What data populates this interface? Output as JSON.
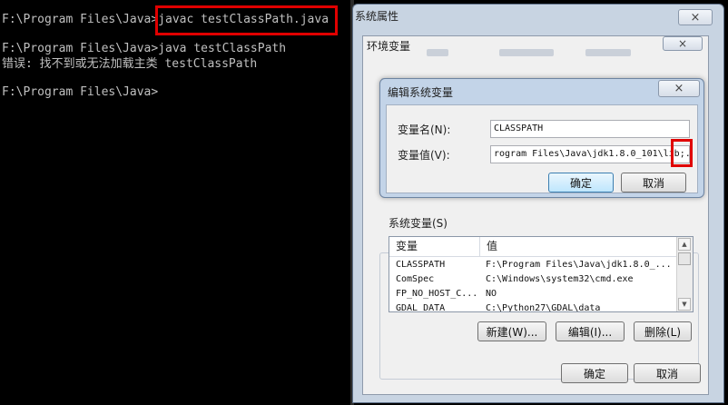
{
  "console": {
    "lines": [
      "F:\\Program Files\\Java>javac testClassPath.java",
      "F:\\Program Files\\Java>java testClassPath",
      "错误: 找不到或无法加载主类 testClassPath",
      "F:\\Program Files\\Java>"
    ]
  },
  "system_properties": {
    "title": "系统属性",
    "close_symbol": "×"
  },
  "env_vars": {
    "title": "环境变量",
    "close_symbol": "×",
    "system_group_label": "系统变量(S)",
    "columns": [
      "变量",
      "值"
    ],
    "rows": [
      {
        "name": "CLASSPATH",
        "value": "F:\\Program Files\\Java\\jdk1.8.0_..."
      },
      {
        "name": "ComSpec",
        "value": "C:\\Windows\\system32\\cmd.exe"
      },
      {
        "name": "FP_NO_HOST_C...",
        "value": "NO"
      },
      {
        "name": "GDAL_DATA",
        "value": "C:\\Python27\\GDAL\\data"
      }
    ],
    "buttons": {
      "new": "新建(W)...",
      "edit": "编辑(I)...",
      "delete": "删除(L)"
    },
    "ok": "确定",
    "cancel": "取消"
  },
  "edit_dialog": {
    "title": "编辑系统变量",
    "close_symbol": "×",
    "name_label": "变量名(N):",
    "name_value": "CLASSPATH",
    "value_label": "变量值(V):",
    "value_value": "rogram Files\\Java\\jdk1.8.0_101\\lib;.",
    "ok": "确定",
    "cancel": "取消"
  }
}
